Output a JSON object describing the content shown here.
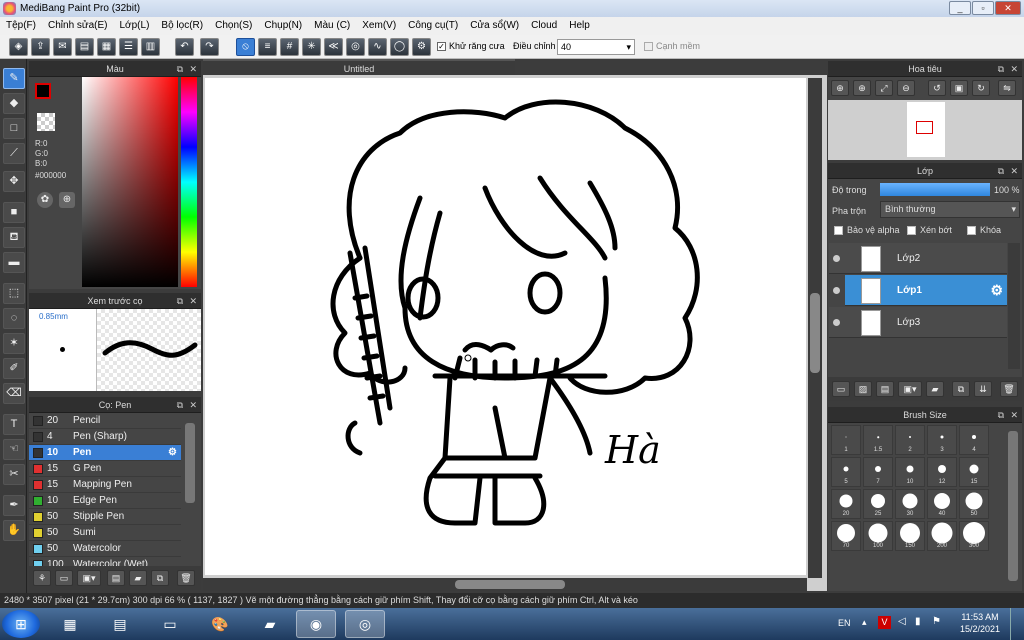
{
  "window": {
    "title": "MediBang Paint Pro (32bit)"
  },
  "menu": [
    "Tệp(F)",
    "Chỉnh sửa(E)",
    "Lớp(L)",
    "Bộ lọc(R)",
    "Chọn(S)",
    "Chụp(N)",
    "Màu (C)",
    "Xem(V)",
    "Công cụ(T)",
    "Cửa sổ(W)",
    "Cloud",
    "Help"
  ],
  "toolbar": {
    "antialias_label": "Khử răng cưa",
    "antialias_checked": true,
    "adjust_label": "Điều chỉnh",
    "adjust_value": "40",
    "soft_edge_label": "Cạnh mềm"
  },
  "color_panel": {
    "title": "Màu",
    "r": "R:0",
    "g": "G:0",
    "b": "B:0",
    "hex": "#000000",
    "fg_color": "#000000"
  },
  "brush_preview": {
    "title": "Xem trước cọ",
    "size": "0.85mm"
  },
  "brush_panel": {
    "title": "Cọ: Pen",
    "brushes": [
      {
        "size": "20",
        "name": "Pencil",
        "color": "#333333"
      },
      {
        "size": "4",
        "name": "Pen (Sharp)",
        "color": "#333333"
      },
      {
        "size": "10",
        "name": "Pen",
        "color": "#333333"
      },
      {
        "size": "15",
        "name": "G Pen",
        "color": "#e03030"
      },
      {
        "size": "15",
        "name": "Mapping Pen",
        "color": "#e03030"
      },
      {
        "size": "10",
        "name": "Edge Pen",
        "color": "#30b030"
      },
      {
        "size": "50",
        "name": "Stipple Pen",
        "color": "#e0d030"
      },
      {
        "size": "50",
        "name": "Sumi",
        "color": "#e0d030"
      },
      {
        "size": "50",
        "name": "Watercolor",
        "color": "#70d0f0"
      },
      {
        "size": "100",
        "name": "Watercolor (Wet)",
        "color": "#70d0f0"
      }
    ]
  },
  "canvas": {
    "tab_title": "Untitled",
    "signature": "Hà"
  },
  "navigator": {
    "title": "Hoa tiêu"
  },
  "layers": {
    "title": "Lớp",
    "opacity_label": "Độ trong",
    "opacity_value": "100 %",
    "opacity_fraction": 1.0,
    "blend_label": "Pha trộn",
    "blend_value": "Bình thường",
    "protect_alpha": "Bảo vệ alpha",
    "clipping": "Xén bớt",
    "lock": "Khóa",
    "items": [
      {
        "name": "Lớp2"
      },
      {
        "name": "Lớp1"
      },
      {
        "name": "Lớp3"
      }
    ]
  },
  "brush_size": {
    "title": "Brush Size",
    "sizes": [
      "1",
      "1.5",
      "2",
      "3",
      "4",
      "5",
      "7",
      "10",
      "12",
      "15",
      "20",
      "25",
      "30",
      "40",
      "50",
      "70",
      "100",
      "150",
      "200",
      "300"
    ]
  },
  "status": {
    "text": "2480 * 3507 pixel   (21 * 29.7cm)   300 dpi   66 %   ( 1137, 1827 )   Vẽ một đường thẳng bằng cách giữ phím Shift, Thay đổi cỡ cọ bằng cách giữ phím Ctrl, Alt và kéo"
  },
  "taskbar": {
    "lang": "EN",
    "time": "11:53 AM",
    "date": "15/2/2021"
  }
}
